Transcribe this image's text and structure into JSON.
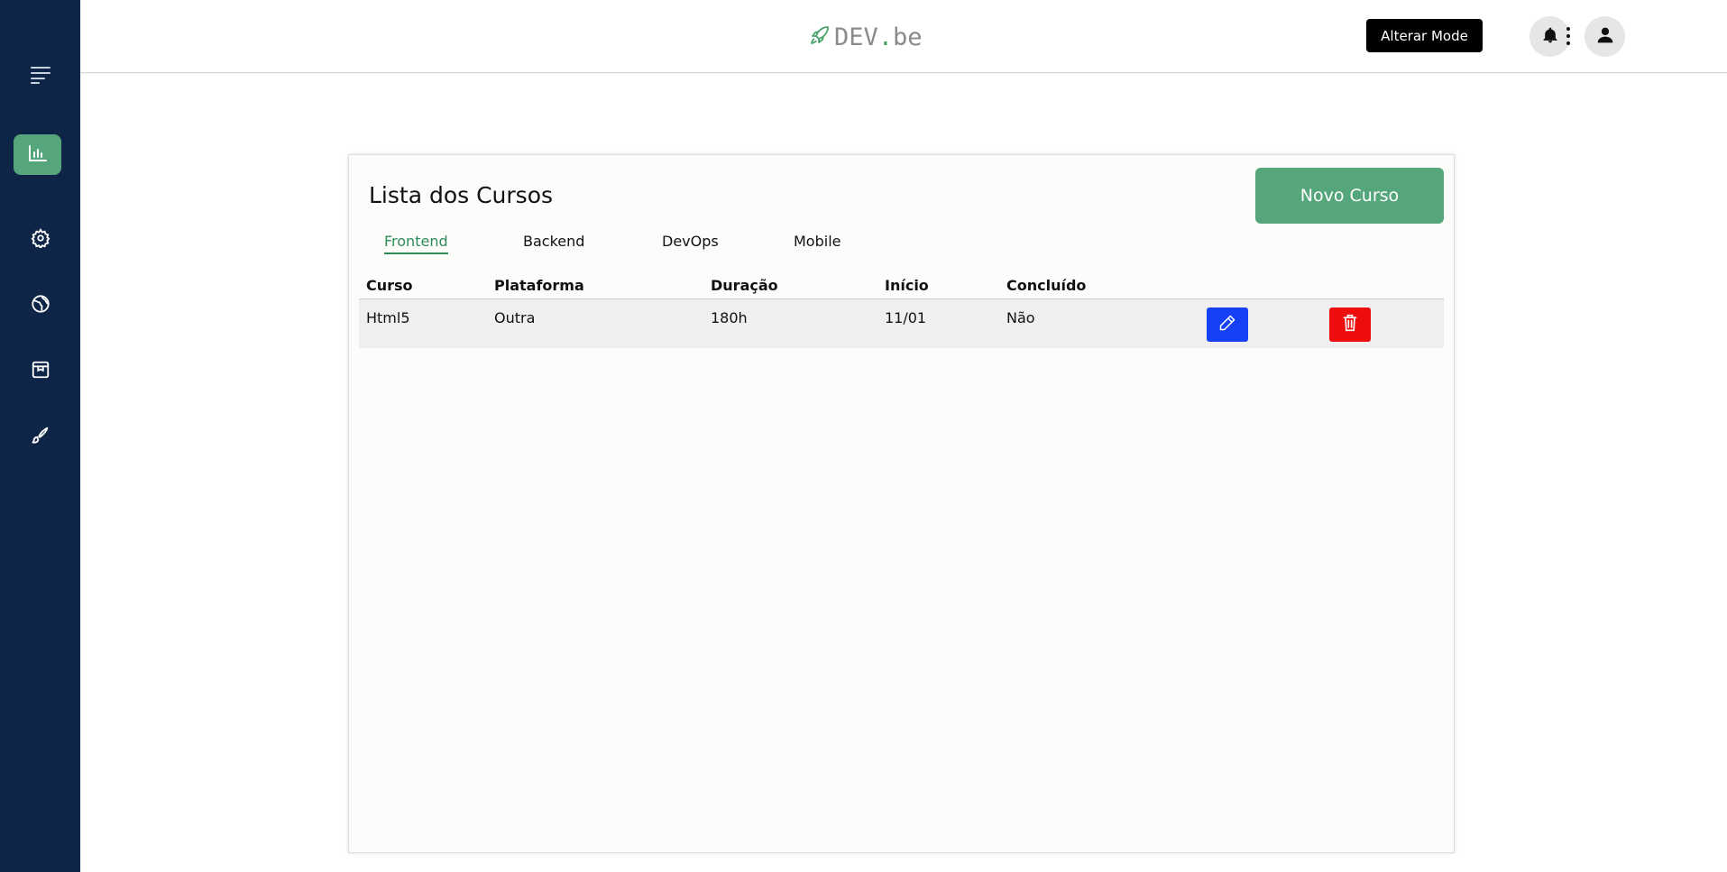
{
  "sidebar": {
    "items": [
      {
        "icon": "menu-icon"
      },
      {
        "icon": "chart-icon",
        "active": true
      },
      {
        "icon": "settings-icon"
      },
      {
        "icon": "globe-icon"
      },
      {
        "icon": "browser-window-icon"
      },
      {
        "icon": "brush-icon"
      }
    ],
    "background": "#0f2547",
    "active_color": "#55a67a"
  },
  "header": {
    "logo_main": "DEV",
    "logo_dot": ".",
    "logo_suffix": "be",
    "alter_mode_label": "Alterar Mode",
    "icons": [
      "bell-icon",
      "user-icon",
      "more-vert-icon"
    ]
  },
  "main": {
    "title": "Lista dos Cursos",
    "new_button_label": "Novo Curso",
    "tabs": [
      {
        "label": "Frontend",
        "active": true
      },
      {
        "label": "Backend",
        "active": false
      },
      {
        "label": "DevOps",
        "active": false
      },
      {
        "label": "Mobile",
        "active": false
      }
    ],
    "table": {
      "headers": [
        "Curso",
        "Plataforma",
        "Duração",
        "Início",
        "Concluído"
      ],
      "rows": [
        {
          "curso": "Html5",
          "plataforma": "Outra",
          "duracao": "180h",
          "inicio": "11/01",
          "concluido": "Não"
        }
      ]
    },
    "colors": {
      "accent": "#55a67a",
      "edit": "#1540f5",
      "delete": "#ee0d0d"
    }
  }
}
